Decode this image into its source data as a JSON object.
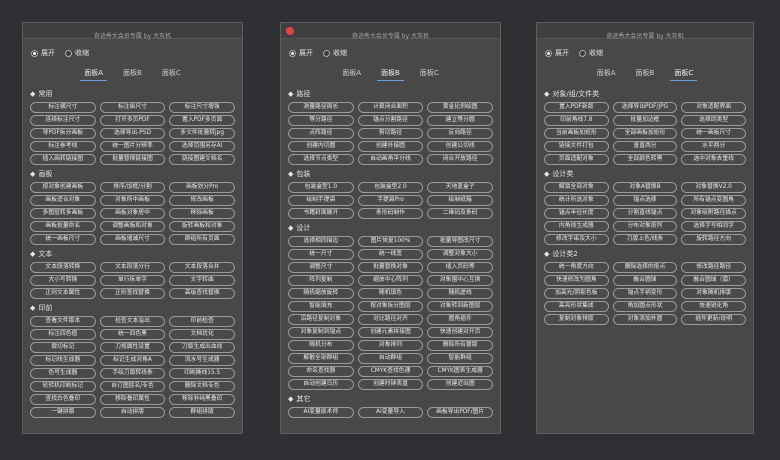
{
  "panels": [
    {
      "title": "奇迹秀大会员专属 by 大灰机",
      "radio": {
        "expand": "展开",
        "collapse": "收缩"
      },
      "tabs": [
        "面板A",
        "面板B",
        "面板C"
      ],
      "active_tab": 0,
      "sections": [
        {
          "title": "常用",
          "buttons": [
            "标注横尺寸",
            "标注纵尺寸",
            "标注尺寸增强",
            "连续标注尺寸",
            "打开多页PDF",
            "置入PDF多页面",
            "导PDF拆分画板",
            "选择导出-PSD",
            "多文件批量转jpg",
            "标注参考线",
            "统一图片分辨率",
            "选择范围另存AI",
            "插入画转链接图",
            "批量替换链接图",
            "链接图建文档名"
          ]
        },
        {
          "title": "画板",
          "buttons": [
            "按对象创建画板",
            "排序/加框/分割",
            "画板划分Pro",
            "画板适合对象",
            "对象所中画板",
            "修改画板",
            "多图层转多画板",
            "画板对象居中",
            "移除画板",
            "画板批量命名",
            "调整画板和对象",
            "旋转画板和对象",
            "统一画板尺寸",
            "画板增减尺寸",
            "群组所有页面"
          ]
        },
        {
          "title": "文本",
          "buttons": [
            "文本段落转换",
            "文本段落分行",
            "文本段落合并",
            "大小写转换",
            "单行拆单字",
            "文字转曲",
            "正则文本属性",
            "正则查找替换",
            "高级查找替换"
          ]
        },
        {
          "title": "印前",
          "buttons": [
            "查看文件版本",
            "检查文本溢出",
            "印前检查",
            "标注四色值",
            "统一四色黑",
            "文档优化",
            "裁切标记",
            "刀规属性设置",
            "刀版生成出血线",
            "标记线生成器",
            "标记生成对角A",
            "流水号生成器",
            "色号生成器",
            "手绘刀版转线条",
            "印刷撕线15.5",
            "轮转机印刷标记",
            "自订图层名/专色",
            "删除文档专色",
            "查找白色叠印",
            "移除叠印属性",
            "移除非纯黑叠印",
            "一键拼版",
            "自动拼版",
            "群组拼版"
          ]
        }
      ]
    },
    {
      "title": "奇迹秀大会员专属 by 大灰机",
      "radio": {
        "expand": "展开",
        "collapse": "收缩"
      },
      "tabs": [
        "面板A",
        "面板B",
        "面板C"
      ],
      "active_tab": 1,
      "sections": [
        {
          "title": "路径",
          "buttons": [
            "测量路径周长",
            "计算闭合面积",
            "黄金比例绘图",
            "等分路径",
            "锚点分割路径",
            "建立等分圆",
            "点阵路径",
            "剪切路径",
            "反向路径",
            "创建内切圆",
            "创建外接圆",
            "创建公切线",
            "选择节点类型",
            "自动画角平分线",
            "闭合开放路径"
          ]
        },
        {
          "title": "包装",
          "buttons": [
            "包装盒型1.0",
            "包装盒型2.0",
            "天地盖盒子",
            "绘制手提袋",
            "手提袋Pro",
            "绘制纸箱",
            "书籍封面展开",
            "条形码制作",
            "二维码及条码"
          ]
        },
        {
          "title": "设计",
          "buttons": [
            "选择相同描边",
            "图片恢复100%",
            "批量导图改尺寸",
            "统一尺寸",
            "统一线宽",
            "调整对象大小",
            "调整尺寸",
            "批量替换对象",
            "插入页码等",
            "阵列复制",
            "缩放中心阵列",
            "对象围中心互换",
            "随机缩放旋转",
            "随机填色",
            "随机虚线",
            "智能填充",
            "按对象拆分图层",
            "对象转到新图层",
            "沿路径复制对象",
            "对比路径对齐",
            "圆角插件",
            "对象复制到锚点",
            "创建元素拼接图",
            "快速创建对开页",
            "随机分布",
            "对象排列",
            "删除所有蒙版",
            "解散全部群组",
            "自动群组",
            "智能群组",
            "命名查找器",
            "CMYK查找色通",
            "CMYK图表生成器",
            "自动创建日历",
            "创建时钟表盘",
            "创建近似图"
          ]
        },
        {
          "title": "其它",
          "buttons": [
            "AI变量原术师",
            "AI变量导入",
            "画板导出PDF/图片"
          ]
        }
      ]
    },
    {
      "title": "奇迹秀大会员专属 by 大灰机",
      "radio": {
        "expand": "展开",
        "collapse": "收缩"
      },
      "tabs": [
        "面板A",
        "面板B",
        "面板C"
      ],
      "active_tab": 2,
      "sections": [
        {
          "title": "对象/组/文件类",
          "buttons": [
            "置入PDF新版",
            "选择导出PDF/JPG",
            "对象适配界面",
            "印前角线7.8",
            "批量加边框",
            "选择同类型",
            "当前画板加矩形",
            "全部画板加矩形",
            "统一画板尺寸",
            "链接文件打包",
            "垂直两分",
            "水平两分",
            "页面适配对象",
            "全部颜色转黑",
            "选中对象去重线"
          ]
        },
        {
          "title": "设计类",
          "buttons": [
            "解锁全部对象",
            "对象A替换B",
            "对象替换V2.0",
            "统计所选对象",
            "锚点选择",
            "所有锚点变圆角",
            "锚点半径长度",
            "分割直线锚点",
            "对象吸附路径描点",
            "内角线生成器",
            "分布对象按列",
            "选择字号相同字",
            "修改字串及大小",
            "刀版上色/线条",
            "旋转路径方向"
          ]
        },
        {
          "title": "设计类2",
          "buttons": [
            "统一角度方向",
            "删除选择的抠点",
            "修改路径路径",
            "快速修改为圆角",
            "融合圆球",
            "融合圆球（弧）",
            "加高光/阴影色板",
            "锚点手柄变形",
            "对象随机排版",
            "高亮形状集成",
            "角加圆点形状",
            "快速锐化角",
            "复制对象排版",
            "对象添加外圆",
            "插件更新/说明"
          ]
        }
      ]
    }
  ],
  "colors": {
    "background": "#2f3033",
    "panel": "#484848",
    "button_border": "#9a9a9a",
    "active_tab_underline": "#6a9fd8",
    "close_button": "#e0463f"
  }
}
